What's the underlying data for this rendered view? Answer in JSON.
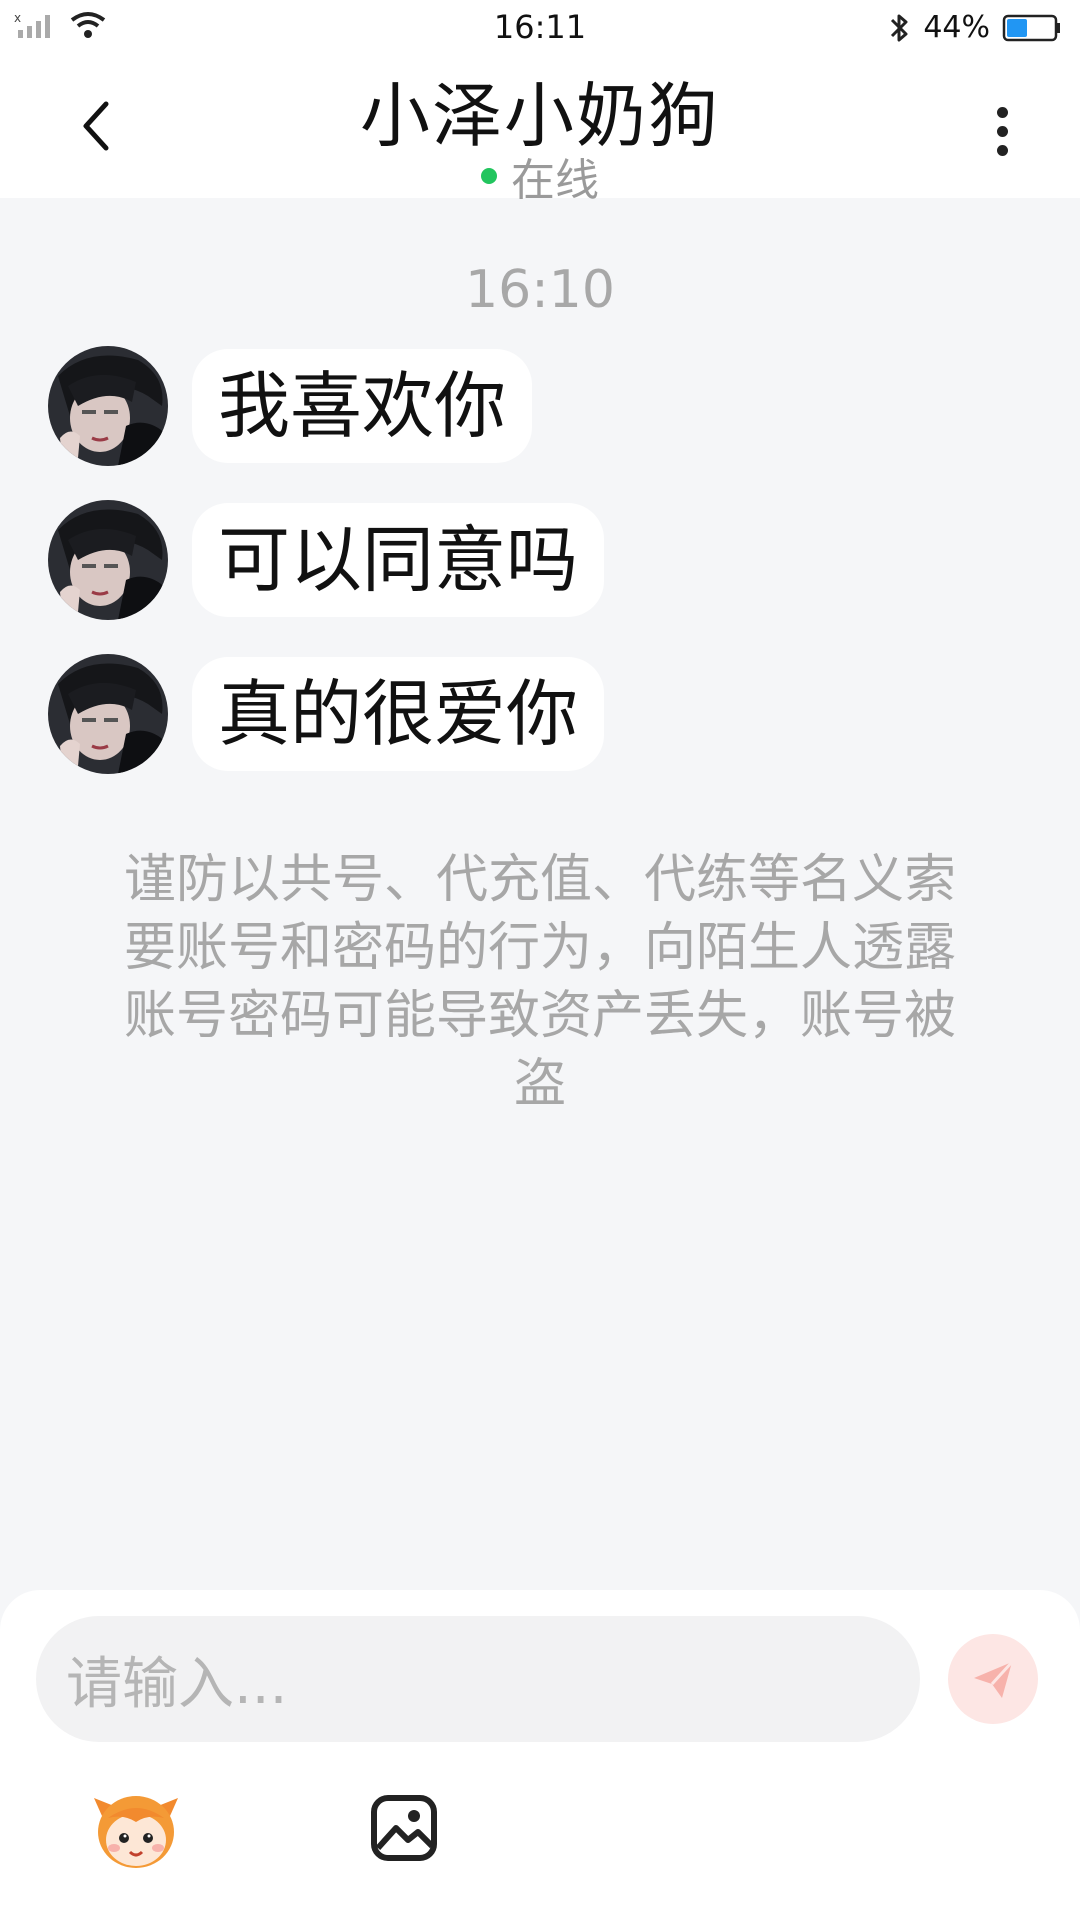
{
  "status_bar": {
    "time": "16:11",
    "battery_percent": "44%",
    "battery_level": 0.44,
    "icons": [
      "signal-icon",
      "wifi-icon",
      "bluetooth-icon",
      "battery-icon"
    ]
  },
  "header": {
    "title": "小泽小奶狗",
    "online_status": "在线",
    "online_color": "#22c55e"
  },
  "chat": {
    "timestamp": "16:10",
    "messages": [
      {
        "text": "我喜欢你"
      },
      {
        "text": "可以同意吗"
      },
      {
        "text": "真的很爱你"
      }
    ],
    "notice": "谨防以共号、代充值、代练等名义索要账号和密码的行为，向陌生人透露账号密码可能导致资产丢失，账号被盗"
  },
  "input": {
    "placeholder": "请输入...",
    "send_color": "#f7b2ab"
  },
  "toolbar": {
    "icons": [
      "emoji-mascot-icon",
      "image-icon"
    ]
  }
}
